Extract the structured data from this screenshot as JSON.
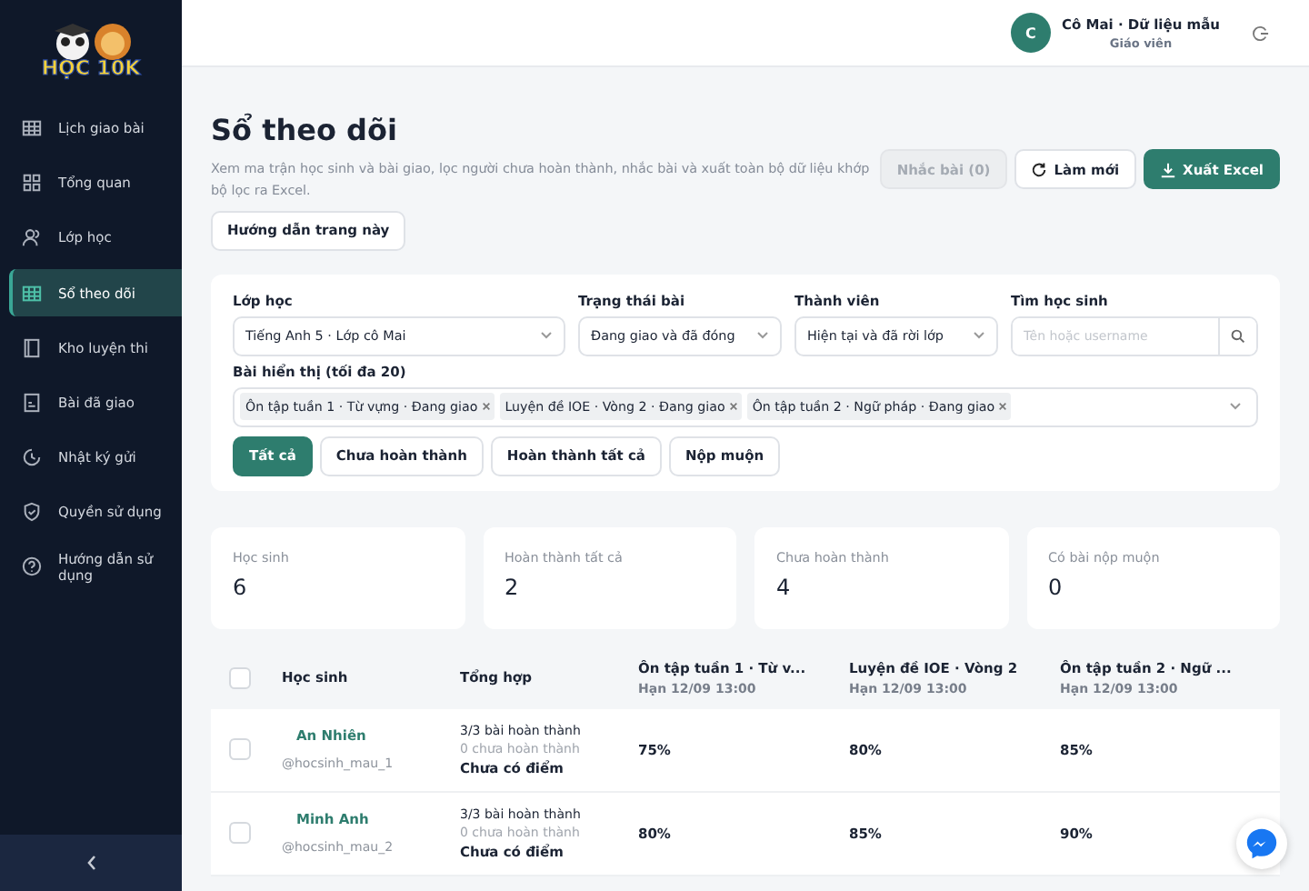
{
  "sidebar": {
    "logo_text": "HỌC 10K",
    "items": [
      {
        "label": "Lịch giao bài",
        "selected": false
      },
      {
        "label": "Tổng quan",
        "selected": false
      },
      {
        "label": "Lớp học",
        "selected": false
      },
      {
        "label": "Sổ theo dõi",
        "selected": true
      },
      {
        "label": "Kho luyện thi",
        "selected": false
      },
      {
        "label": "Bài đã giao",
        "selected": false
      },
      {
        "label": "Nhật ký gửi",
        "selected": false
      },
      {
        "label": "Quyền sử dụng",
        "selected": false
      },
      {
        "label": "Hướng dẫn sử dụng",
        "selected": false
      }
    ]
  },
  "header": {
    "avatar": "C",
    "user_name": "Cô Mai · Dữ liệu mẫu",
    "role": "Giáo viên"
  },
  "page": {
    "title": "Sổ theo dõi",
    "description": "Xem ma trận học sinh và bài giao, lọc người chưa hoàn thành, nhắc bài và xuất toàn bộ dữ liệu khớp bộ lọc ra Excel.",
    "guide_button": "Hướng dẫn trang này",
    "actions": [
      {
        "label": "Nhắc bài (0)",
        "kind": "plain",
        "disabled": true
      },
      {
        "label": "Làm mới",
        "kind": "refresh",
        "disabled": false
      },
      {
        "label": "Xuất Excel",
        "kind": "export",
        "disabled": false
      }
    ]
  },
  "filters": {
    "fields": [
      {
        "label": "Lớp học",
        "value": "Tiếng Anh 5 · Lớp cô Mai",
        "kind": "select"
      },
      {
        "label": "Trạng thái bài",
        "value": "Đang giao và đã đóng",
        "kind": "select"
      },
      {
        "label": "Thành viên",
        "value": "Hiện tại và đã rời lớp",
        "kind": "select"
      },
      {
        "label": "Tìm học sinh",
        "placeholder": "Tên hoặc username",
        "kind": "search"
      }
    ],
    "assignments_label": "Bài hiển thị (tối đa 20)",
    "chips": [
      "Ôn tập tuần 1 · Từ vựng · Đang giao",
      "Luyện đề IOE · Vòng 2 · Đang giao",
      "Ôn tập tuần 2 · Ngữ pháp · Đang giao"
    ],
    "segments": [
      {
        "label": "Tất cả",
        "selected": true
      },
      {
        "label": "Chưa hoàn thành",
        "selected": false
      },
      {
        "label": "Hoàn thành tất cả",
        "selected": false
      },
      {
        "label": "Nộp muộn",
        "selected": false
      }
    ]
  },
  "stats": [
    {
      "label": "Học sinh",
      "value": "6"
    },
    {
      "label": "Hoàn thành tất cả",
      "value": "2"
    },
    {
      "label": "Chưa hoàn thành",
      "value": "4"
    },
    {
      "label": "Có bài nộp muộn",
      "value": "0"
    }
  ],
  "table": {
    "select_all": false,
    "columns": [
      {
        "title": "Học sinh"
      },
      {
        "title": "Tổng hợp"
      },
      {
        "title": "Ôn tập tuần 1 · Từ v...",
        "due": "Hạn 12/09 13:00"
      },
      {
        "title": "Luyện đề IOE · Vòng 2",
        "due": "Hạn 12/09 13:00"
      },
      {
        "title": "Ôn tập tuần 2 · Ngữ ...",
        "due": "Hạn 12/09 13:00"
      }
    ],
    "rows": [
      {
        "name": "An Nhiên",
        "username": "@hocsinh_mau_1",
        "completed": "3/3 bài hoàn thành",
        "incomplete": "0 chưa hoàn thành",
        "score": "Chưa có điểm",
        "checked": false,
        "results": [
          "75%",
          "80%",
          "85%"
        ]
      },
      {
        "name": "Minh Anh",
        "username": "@hocsinh_mau_2",
        "completed": "3/3 bài hoàn thành",
        "incomplete": "0 chưa hoàn thành",
        "score": "Chưa có điểm",
        "checked": false,
        "results": [
          "80%",
          "85%",
          "90%"
        ]
      }
    ]
  }
}
